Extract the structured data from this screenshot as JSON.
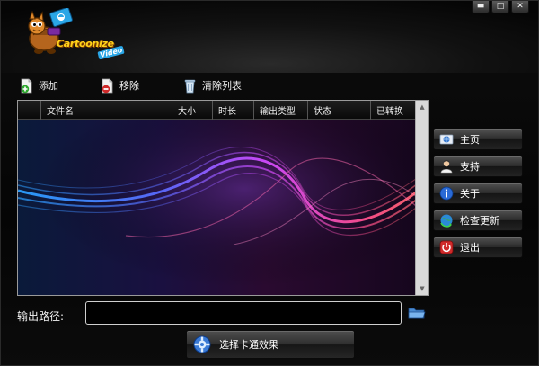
{
  "window": {
    "controls": [
      {
        "name": "minimize",
        "glyph": "▬"
      },
      {
        "name": "maximize",
        "glyph": "□"
      },
      {
        "name": "close",
        "glyph": "✕"
      }
    ]
  },
  "logo": {
    "line1": "Cartoonize",
    "line2": "Video"
  },
  "toolbar": {
    "add_label": "添加",
    "remove_label": "移除",
    "clear_label": "清除列表"
  },
  "list": {
    "columns": [
      "",
      "文件名",
      "大小",
      "时长",
      "输出类型",
      "状态",
      "已转换"
    ],
    "rows": [],
    "scroll_up": "▲",
    "scroll_down": "▼"
  },
  "side_buttons": {
    "home_label": "主页",
    "support_label": "支持",
    "about_label": "关于",
    "update_label": "检查更新",
    "exit_label": "退出"
  },
  "output": {
    "label": "输出路径:",
    "value": "",
    "placeholder": ""
  },
  "main_action": {
    "label": "选择卡通效果"
  },
  "colors": {
    "background": "#000000",
    "logo_yellow": "#ffd21a",
    "accent_blue": "#2aa6e6",
    "wave_pink": "#ff4fa0",
    "wave_blue": "#3a8cff"
  }
}
